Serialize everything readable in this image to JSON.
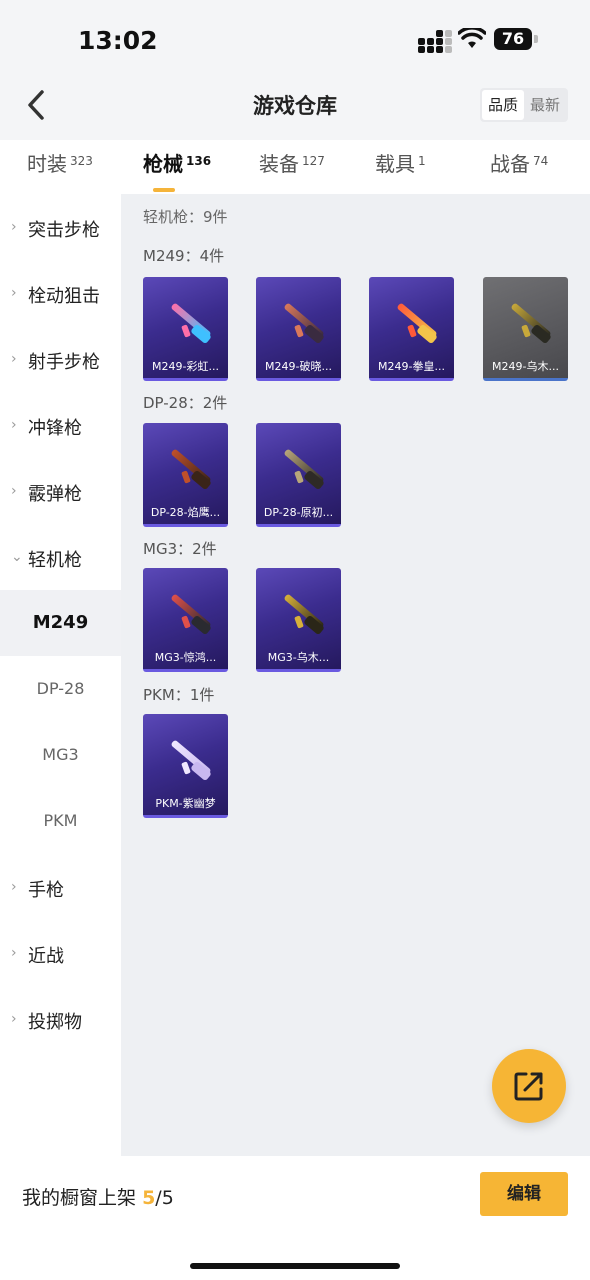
{
  "status": {
    "time": "13:02",
    "battery": "76"
  },
  "header": {
    "title": "游戏仓库",
    "sort_options": [
      "品质",
      "最新"
    ]
  },
  "tabs": [
    {
      "label": "时装",
      "count": "323"
    },
    {
      "label": "枪械",
      "count": "136"
    },
    {
      "label": "装备",
      "count": "127"
    },
    {
      "label": "载具",
      "count": "1"
    },
    {
      "label": "战备",
      "count": "74"
    }
  ],
  "sidebar": {
    "categories": [
      "突击步枪",
      "栓动狙击",
      "射手步枪",
      "冲锋枪",
      "霰弹枪",
      "轻机枪"
    ],
    "subitems": [
      "M249",
      "DP-28",
      "MG3",
      "PKM"
    ],
    "categories_after": [
      "手枪",
      "近战",
      "投掷物"
    ]
  },
  "content": {
    "total": "轻机枪：9件",
    "groups": [
      {
        "title": "M249：4件",
        "items": [
          {
            "name": "M249-彩虹...",
            "c1": "#ff6fa8",
            "c2": "#3fc0ff",
            "grey": false
          },
          {
            "name": "M249-破晓...",
            "c1": "#d9785a",
            "c2": "#3a2b40",
            "grey": false
          },
          {
            "name": "M249-拳皇...",
            "c1": "#ff5a3a",
            "c2": "#f3c44a",
            "grey": false
          },
          {
            "name": "M249-乌木...",
            "c1": "#c8a93a",
            "c2": "#2a2a22",
            "grey": true
          }
        ]
      },
      {
        "title": "DP-28：2件",
        "items": [
          {
            "name": "DP-28-焰鹰...",
            "c1": "#c0502a",
            "c2": "#3a2418",
            "grey": false
          },
          {
            "name": "DP-28-原初...",
            "c1": "#b8a67a",
            "c2": "#2e2a26",
            "grey": false
          }
        ]
      },
      {
        "title": "MG3：2件",
        "items": [
          {
            "name": "MG3-惊鸿...",
            "c1": "#e0504a",
            "c2": "#2a2a30",
            "grey": false
          },
          {
            "name": "MG3-乌木...",
            "c1": "#d7b03a",
            "c2": "#2a2618",
            "grey": false
          }
        ]
      },
      {
        "title": "PKM：1件",
        "items": [
          {
            "name": "PKM-紫幽梦",
            "c1": "#f0e8ff",
            "c2": "#c9b8f0",
            "grey": false
          }
        ]
      }
    ]
  },
  "bottom": {
    "label": "我的橱窗上架",
    "current": "5",
    "total": "/5",
    "edit": "编辑"
  },
  "colors": {
    "accent": "#f5b43a",
    "card_purple": "#3b2c8e"
  },
  "icons": [
    "back-icon",
    "share-icon",
    "chevron-right-icon",
    "chevron-down-icon",
    "wifi-icon",
    "battery-icon",
    "signal-icon"
  ]
}
